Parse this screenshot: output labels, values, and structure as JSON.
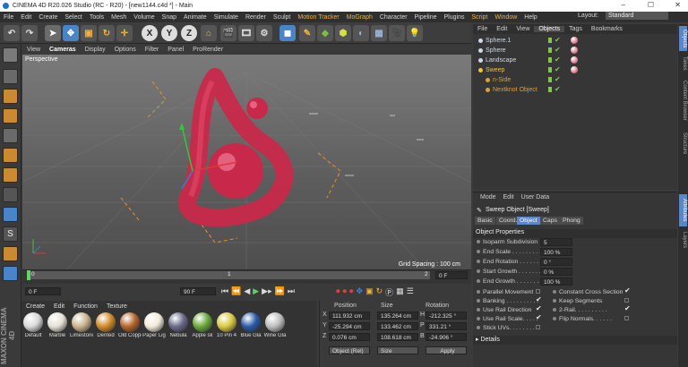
{
  "window": {
    "title": "CINEMA 4D R20.026 Studio (RC - R20) - [new1144.c4d *] - Main",
    "min": "–",
    "max": "☐",
    "close": "✕"
  },
  "menu": {
    "items": [
      "File",
      "Edit",
      "Create",
      "Select",
      "Tools",
      "Mesh",
      "Volume",
      "Snap",
      "Animate",
      "Simulate",
      "Render",
      "Sculpt",
      "Motion Tracker",
      "MoGraph",
      "Character",
      "Pipeline",
      "Plugins",
      "Script",
      "Window",
      "Help"
    ],
    "layout_label": "Layout:",
    "layout_value": "Standard"
  },
  "toolbar": {
    "x": "X",
    "y": "Y",
    "z": "Z"
  },
  "viewport": {
    "menu": [
      "View",
      "Cameras",
      "Display",
      "Options",
      "Filter",
      "Panel",
      "ProRender"
    ],
    "label": "Perspective",
    "grid_spacing": "Grid Spacing : 100 cm"
  },
  "timeline": {
    "ticks": [
      "0",
      "1",
      "2"
    ],
    "frame_right": "0 F",
    "start": "0 F",
    "end": "90 F"
  },
  "materials": {
    "menu": [
      "Create",
      "Edit",
      "Function",
      "Texture"
    ],
    "items": [
      {
        "name": "Default",
        "color": "#d8d8d8"
      },
      {
        "name": "Marble",
        "color": "#e5e0d5"
      },
      {
        "name": "Limestone",
        "color": "#c9b48e"
      },
      {
        "name": "Dented",
        "color": "#d08a2a"
      },
      {
        "name": "Old Copper",
        "color": "#b5652a"
      },
      {
        "name": "Paper Lig",
        "color": "#f1ead8"
      },
      {
        "name": "Nebula",
        "color": "#6a6a8a"
      },
      {
        "name": "Apple sk",
        "color": "#6aa83a"
      },
      {
        "name": "10 Pin 4",
        "color": "#d8c840"
      },
      {
        "name": "Blue Gla",
        "color": "#2a5aa8"
      },
      {
        "name": "Wine Gla",
        "color": "#bdbdbd"
      }
    ]
  },
  "coords": {
    "headers": [
      "Position",
      "Size",
      "Rotation"
    ],
    "rows": [
      {
        "axis": "X",
        "pos": "111.932 cm",
        "size": "135.264 cm",
        "rot_axis": "H",
        "rot": "-212.325 °"
      },
      {
        "axis": "Y",
        "pos": "-25.294 cm",
        "size": "133.462 cm",
        "rot_axis": "P",
        "rot": "331.21 °"
      },
      {
        "axis": "Z",
        "pos": "0.076 cm",
        "size": "108.618 cm",
        "rot_axis": "B",
        "rot": "-24.906 °"
      }
    ],
    "mode": "Object (Rel)",
    "size_mode": "Size",
    "apply": "Apply"
  },
  "objects": {
    "menu": [
      "File",
      "Edit",
      "View",
      "Objects",
      "Tags",
      "Bookmarks"
    ],
    "items": [
      {
        "name": "Sphere.1",
        "color": "#cfd8e8",
        "indent": 0
      },
      {
        "name": "Sphere",
        "color": "#cfd8e8",
        "indent": 0
      },
      {
        "name": "Landscape",
        "color": "#cfd8e8",
        "indent": 0
      },
      {
        "name": "Sweep",
        "color": "#f0c040",
        "indent": 0
      },
      {
        "name": "n-Side",
        "color": "#d8a040",
        "indent": 1
      },
      {
        "name": "Nextknot Object",
        "color": "#d8a040",
        "indent": 1
      }
    ]
  },
  "attributes": {
    "menu": [
      "Mode",
      "Edit",
      "User Data"
    ],
    "title": "Sweep Object [Sweep]",
    "tabs": [
      "Basic",
      "Coord.",
      "Object",
      "Caps",
      "Phong"
    ],
    "section": "Object Properties",
    "props": [
      {
        "label": "Isoparm Subdivision",
        "value": "5"
      },
      {
        "label": "End Scale . . . . . . . . .",
        "value": "100 %"
      },
      {
        "label": "End Rotation . . . . . . .",
        "value": "0 °"
      },
      {
        "label": "Start Growth . . . . . . .",
        "value": "0 %"
      },
      {
        "label": "End Growth . . . . . . . .",
        "value": "100 %"
      }
    ],
    "checks_left": [
      {
        "label": "Parallel Movement",
        "checked": false
      },
      {
        "label": "Banking . . . . . . . . . .",
        "checked": true
      },
      {
        "label": "Use Rail Direction",
        "checked": true
      },
      {
        "label": "Use Rail Scale. . . . .",
        "checked": true
      },
      {
        "label": "Stick UVs. . . . . . . .",
        "checked": false
      }
    ],
    "checks_right": [
      {
        "label": "Constant Cross Section",
        "checked": true
      },
      {
        "label": "Keep Segments",
        "checked": false
      },
      {
        "label": "2-Rail. . . . . . . . . .",
        "checked": true
      },
      {
        "label": "Flip Normals. . . . . .",
        "checked": false
      }
    ],
    "details": "Details",
    "check_mark": "✔"
  },
  "vtabs": [
    "Objects",
    "Takes",
    "Content Browser",
    "Structure",
    "Attributes",
    "Layers"
  ],
  "brand": "MAXON CINEMA 4D",
  "colors": {
    "accent": "#5b87c2",
    "highlight": "#f0b43c",
    "object": "#c8294a"
  }
}
